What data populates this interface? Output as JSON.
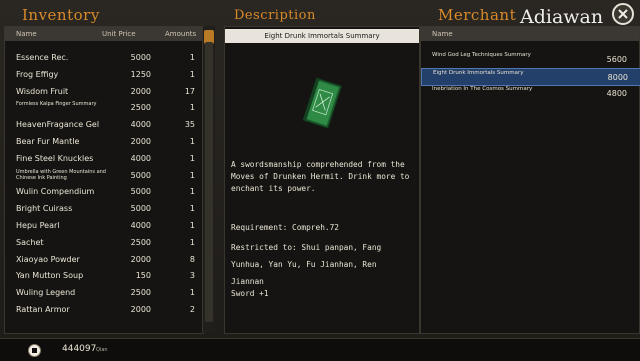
{
  "headers": {
    "inventory": "Inventory",
    "description": "Description",
    "merchant": "Merchant"
  },
  "watermark": "Adiawan",
  "inventory": {
    "columns": {
      "name": "Name",
      "price": "Unit Price",
      "amount": "Amounts"
    },
    "items": [
      {
        "name": "Essence Rec.",
        "price": "5000",
        "amount": "1"
      },
      {
        "name": "Frog Effigy",
        "price": "1250",
        "amount": "1"
      },
      {
        "name": "Wisdom Fruit",
        "price": "2000",
        "amount": "17"
      },
      {
        "name": "Formless Kalpa Finger Summary",
        "price": "2500",
        "amount": "1"
      },
      {
        "name": "HeavenFragance Gel",
        "price": "4000",
        "amount": "35"
      },
      {
        "name": "Bear Fur Mantle",
        "price": "2000",
        "amount": "1"
      },
      {
        "name": "Fine Steel Knuckles",
        "price": "4000",
        "amount": "1"
      },
      {
        "name": "Umbrella with Green Mountains and Chinese Ink Painting",
        "price": "5000",
        "amount": "1"
      },
      {
        "name": "Wulin Compendium",
        "price": "5000",
        "amount": "1"
      },
      {
        "name": "Bright Cuirass",
        "price": "5000",
        "amount": "1"
      },
      {
        "name": "Hepu Pearl",
        "price": "4000",
        "amount": "1"
      },
      {
        "name": "Sachet",
        "price": "2500",
        "amount": "1"
      },
      {
        "name": "Xiaoyao Powder",
        "price": "2000",
        "amount": "8"
      },
      {
        "name": "Yan Mutton Soup",
        "price": "150",
        "amount": "3"
      },
      {
        "name": "Wuling Legend",
        "price": "2500",
        "amount": "1"
      },
      {
        "name": "Rattan Armor",
        "price": "2000",
        "amount": "2"
      }
    ]
  },
  "description": {
    "title": "Eight Drunk Immortals Summary",
    "text": "A swordsmanship comprehended from the Moves of Drunken Hermit. Drink more to enchant its power.",
    "requirement": "Requirement: Compreh.72",
    "restricted": "Restricted to: Shui panpan, Fang Yunhua, Yan Yu, Fu Jianhan, Ren Jiannan",
    "bonus": "Sword +1"
  },
  "merchant": {
    "columns": {
      "name": "Name"
    },
    "items": [
      {
        "name": "Wind God Leg Techniques Summary",
        "price": "5600",
        "selected": false
      },
      {
        "name": "Eight Drunk Immortals Summary",
        "price": "8000",
        "selected": true
      },
      {
        "name": "Inebriation In The Cosmos Summary",
        "price": "4800",
        "selected": false
      }
    ]
  },
  "wallet": {
    "amount": "444097",
    "unit": "Qian"
  }
}
